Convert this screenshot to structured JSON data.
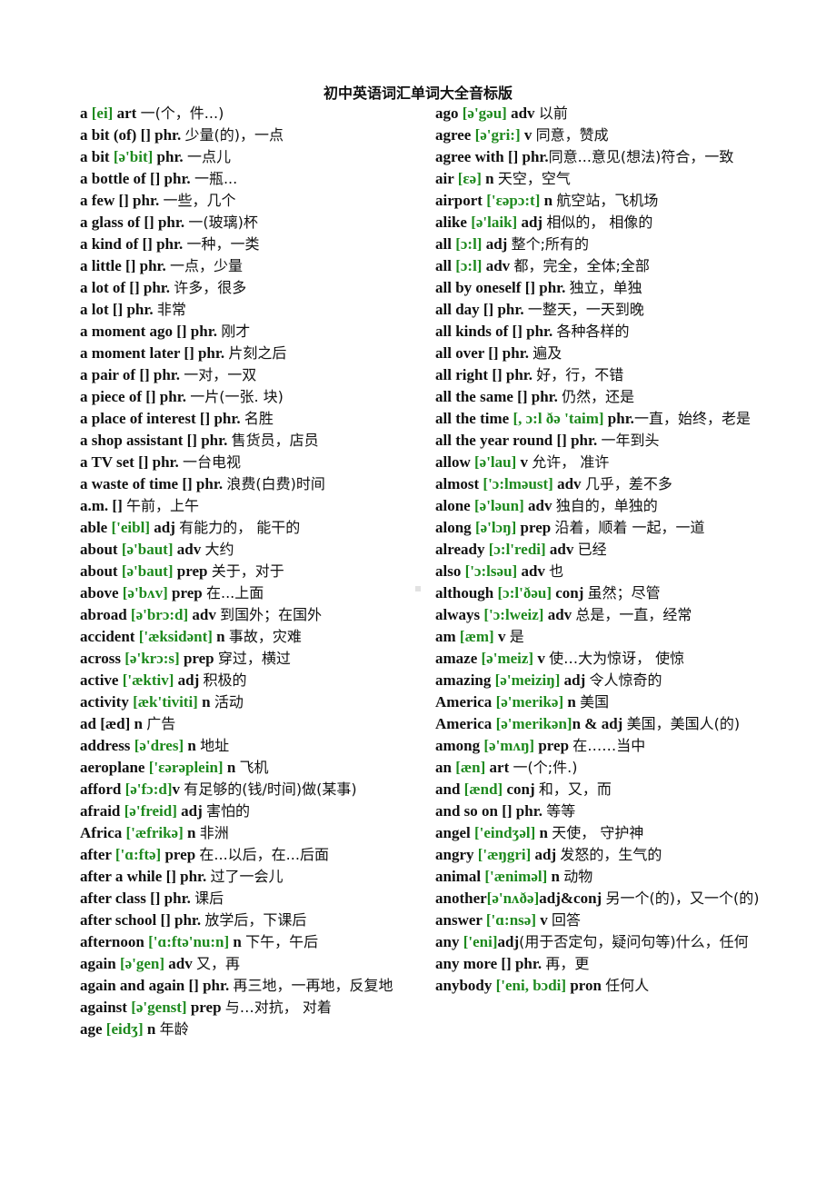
{
  "title": "初中英语词汇单词大全音标版",
  "colors": {
    "phonetic": "#1e8a1e",
    "text": "#111111"
  },
  "left_column": [
    {
      "word": "a ",
      "phonetic": "[ei]",
      "rest": " art ",
      "cn": "一(个，件...)"
    },
    {
      "word": "a bit (of) [] phr. ",
      "phonetic": "",
      "rest": "",
      "cn": "少量(的)，一点"
    },
    {
      "word": "a bit ",
      "phonetic": "[ə'bit]",
      "rest": " phr. ",
      "cn": "一点儿"
    },
    {
      "word": "a bottle of [] phr. ",
      "phonetic": "",
      "rest": "",
      "cn": "一瓶..."
    },
    {
      "word": "a few [] phr. ",
      "phonetic": "",
      "rest": "",
      "cn": "一些，几个"
    },
    {
      "word": "a glass of [] phr. ",
      "phonetic": "",
      "rest": "",
      "cn": "一(玻璃)杯"
    },
    {
      "word": "a kind of [] phr. ",
      "phonetic": "",
      "rest": "",
      "cn": "一种，一类"
    },
    {
      "word": "a little [] phr. ",
      "phonetic": "",
      "rest": "",
      "cn": "一点，少量"
    },
    {
      "word": "a lot of [] phr. ",
      "phonetic": "",
      "rest": "",
      "cn": "许多，很多"
    },
    {
      "word": "a lot [] phr. ",
      "phonetic": "",
      "rest": "",
      "cn": "非常"
    },
    {
      "word": "a moment ago [] phr. ",
      "phonetic": "",
      "rest": "",
      "cn": "刚才"
    },
    {
      "word": "a moment later [] phr. ",
      "phonetic": "",
      "rest": "",
      "cn": "片刻之后"
    },
    {
      "word": "a pair of [] phr. ",
      "phonetic": "",
      "rest": "",
      "cn": "一对，一双"
    },
    {
      "word": "a piece of [] phr. ",
      "phonetic": "",
      "rest": "",
      "cn": "一片(一张. 块)"
    },
    {
      "word": "a place of interest [] phr. ",
      "phonetic": "",
      "rest": "",
      "cn": "名胜"
    },
    {
      "word": "a shop assistant [] phr. ",
      "phonetic": "",
      "rest": "",
      "cn": "售货员，店员"
    },
    {
      "word": "a TV set [] phr. ",
      "phonetic": "",
      "rest": "",
      "cn": "一台电视"
    },
    {
      "word": "a waste of time [] phr. ",
      "phonetic": "",
      "rest": "",
      "cn": "浪费(白费)时间"
    },
    {
      "word": "a.m.    [] ",
      "phonetic": "",
      "rest": "",
      "cn": "午前，上午"
    },
    {
      "word": "able ",
      "phonetic": "['eibl]",
      "rest": " adj ",
      "cn": "有能力的， 能干的"
    },
    {
      "word": "about ",
      "phonetic": "[ə'baut]",
      "rest": " adv ",
      "cn": "大约"
    },
    {
      "word": "about ",
      "phonetic": "[ə'baut]",
      "rest": " prep ",
      "cn": "关于，对于"
    },
    {
      "word": "above ",
      "phonetic": "[ə'bʌv]",
      "rest": " prep ",
      "cn": "在...上面"
    },
    {
      "word": "abroad ",
      "phonetic": "[ə'brɔ:d]",
      "rest": " adv ",
      "cn": "到国外；在国外"
    },
    {
      "word": "accident ",
      "phonetic": "['æksidənt]",
      "rest": " n ",
      "cn": "事故，灾难"
    },
    {
      "word": "across ",
      "phonetic": "[ə'krɔ:s]",
      "rest": " prep ",
      "cn": "穿过，横过"
    },
    {
      "word": "active ",
      "phonetic": "['æktiv]",
      "rest": " adj ",
      "cn": "积极的"
    },
    {
      "word": "activity ",
      "phonetic": "[æk'tiviti]",
      "rest": " n ",
      "cn": "活动"
    },
    {
      "word": "ad [æd] n ",
      "phonetic": "",
      "rest": "",
      "cn": "广告"
    },
    {
      "word": "address ",
      "phonetic": "[ə'dres]",
      "rest": " n ",
      "cn": "地址"
    },
    {
      "word": "aeroplane ",
      "phonetic": "['ɛərəplein]",
      "rest": " n ",
      "cn": "飞机"
    },
    {
      "word": "afford ",
      "phonetic": "[ə'fɔ:d]",
      "rest": "v ",
      "cn": "有足够的(钱/时间)做(某事)"
    },
    {
      "word": "afraid ",
      "phonetic": "[ə'freid]",
      "rest": " adj ",
      "cn": "害怕的"
    },
    {
      "word": "Africa ",
      "phonetic": "['æfrikə]",
      "rest": " n ",
      "cn": "非洲"
    },
    {
      "word": "after ",
      "phonetic": "['ɑ:ftə]",
      "rest": " prep ",
      "cn": "在...以后，在...后面"
    },
    {
      "word": "after a while [] phr. ",
      "phonetic": "",
      "rest": "",
      "cn": "过了一会儿"
    },
    {
      "word": "after class [] phr. ",
      "phonetic": "",
      "rest": "",
      "cn": "课后"
    },
    {
      "word": "after school [] phr. ",
      "phonetic": "",
      "rest": "",
      "cn": "放学后，下课后"
    },
    {
      "word": "afternoon ",
      "phonetic": "['ɑ:ftə'nu:n]",
      "rest": " n ",
      "cn": "下午，午后"
    },
    {
      "word": "again ",
      "phonetic": "[ə'gen]",
      "rest": " adv ",
      "cn": "又，再"
    },
    {
      "word": "again and again    [] phr. ",
      "phonetic": "",
      "rest": "",
      "cn": "再三地，一再地，反复地"
    },
    {
      "word": "against ",
      "phonetic": "[ə'genst]",
      "rest": " prep ",
      "cn": "与…对抗， 对着"
    },
    {
      "word": "age ",
      "phonetic": "[eidʒ]",
      "rest": " n ",
      "cn": "年龄"
    }
  ],
  "right_column": [
    {
      "word": "ago ",
      "phonetic": "[ə'gəu]",
      "rest": " adv ",
      "cn": "以前"
    },
    {
      "word": "agree ",
      "phonetic": "[ə'gri:]",
      "rest": " v ",
      "cn": "同意，赞成"
    },
    {
      "word": "agree with    [] phr.",
      "phonetic": "",
      "rest": "",
      "cn": "同意...意见(想法)符合，一致"
    },
    {
      "word": "air ",
      "phonetic": "[ɛə]",
      "rest": " n ",
      "cn": "天空，空气"
    },
    {
      "word": "airport ",
      "phonetic": "['ɛəpɔ:t]",
      "rest": " n ",
      "cn": "航空站，飞机场"
    },
    {
      "word": "alike ",
      "phonetic": "[ə'laik]",
      "rest": " adj ",
      "cn": "相似的， 相像的"
    },
    {
      "word": "all ",
      "phonetic": "[ɔ:l]",
      "rest": " adj ",
      "cn": "整个;所有的"
    },
    {
      "word": "all ",
      "phonetic": "[ɔ:l]",
      "rest": " adv ",
      "cn": "都，完全，全体;全部"
    },
    {
      "word": "all by oneself [] phr. ",
      "phonetic": "",
      "rest": "",
      "cn": "独立，单独"
    },
    {
      "word": "all day [] phr. ",
      "phonetic": "",
      "rest": "",
      "cn": "一整天，一天到晚"
    },
    {
      "word": "all kinds of [] phr. ",
      "phonetic": "",
      "rest": "",
      "cn": "各种各样的"
    },
    {
      "word": "all over [] phr. ",
      "phonetic": "",
      "rest": "",
      "cn": "遍及"
    },
    {
      "word": "all right    [] phr. ",
      "phonetic": "",
      "rest": "",
      "cn": "好，行，不错"
    },
    {
      "word": "all the same [] phr. ",
      "phonetic": "",
      "rest": "",
      "cn": "仍然，还是"
    },
    {
      "word": "all the time ",
      "phonetic": "[, ɔ:l ðə 'taim]",
      "rest": " phr.",
      "cn": "一直，始终，老是"
    },
    {
      "word": "all the year round [] phr. ",
      "phonetic": "",
      "rest": "",
      "cn": "一年到头"
    },
    {
      "word": "allow ",
      "phonetic": "[ə'lau]",
      "rest": " v ",
      "cn": "允许， 准许"
    },
    {
      "word": "almost ",
      "phonetic": "['ɔ:lməust]",
      "rest": " adv ",
      "cn": "几乎，差不多"
    },
    {
      "word": "alone ",
      "phonetic": "[ə'ləun]",
      "rest": " adv ",
      "cn": "独自的，单独的"
    },
    {
      "word": "along ",
      "phonetic": "[ə'lɔŋ]",
      "rest": " prep ",
      "cn": "沿着，顺着 一起，一道"
    },
    {
      "word": "already ",
      "phonetic": "[ɔ:l'redi]",
      "rest": " adv ",
      "cn": "已经"
    },
    {
      "word": "also ",
      "phonetic": "['ɔ:lsəu]",
      "rest": " adv ",
      "cn": "也"
    },
    {
      "word": "although ",
      "phonetic": "[ɔ:l'ðəu]",
      "rest": " conj ",
      "cn": "虽然；尽管"
    },
    {
      "word": "always ",
      "phonetic": "['ɔ:lweiz]",
      "rest": " adv ",
      "cn": "总是，一直，经常"
    },
    {
      "word": "am ",
      "phonetic": "[æm]",
      "rest": " v ",
      "cn": "是"
    },
    {
      "word": "amaze ",
      "phonetic": "[ə'meiz]",
      "rest": " v ",
      "cn": "使…大为惊讶， 使惊"
    },
    {
      "word": "amazing ",
      "phonetic": "[ə'meiziŋ]",
      "rest": " adj ",
      "cn": "令人惊奇的"
    },
    {
      "word": "America ",
      "phonetic": "[ə'merikə]",
      "rest": " n ",
      "cn": "美国"
    },
    {
      "word": "America ",
      "phonetic": "[ə'merikən]",
      "rest": "n & adj ",
      "cn": "美国，美国人(的)"
    },
    {
      "word": "among ",
      "phonetic": "[ə'mʌŋ]",
      "rest": " prep ",
      "cn": "在……当中"
    },
    {
      "word": "an ",
      "phonetic": "[æn]",
      "rest": " art ",
      "cn": "一(个;件.)"
    },
    {
      "word": "and ",
      "phonetic": "[ænd]",
      "rest": " conj ",
      "cn": "和，又，而"
    },
    {
      "word": "and so on [] phr. ",
      "phonetic": "",
      "rest": "",
      "cn": "等等"
    },
    {
      "word": "angel ",
      "phonetic": "['eindʒəl]",
      "rest": " n ",
      "cn": "天使， 守护神"
    },
    {
      "word": "angry ",
      "phonetic": "['æŋgri]",
      "rest": " adj ",
      "cn": "发怒的，生气的"
    },
    {
      "word": "animal ",
      "phonetic": "['æniməl]",
      "rest": " n ",
      "cn": "动物"
    },
    {
      "word": "another",
      "phonetic": "[ə'nʌðə]",
      "rest": "adj&conj ",
      "cn": "另一个(的)，又一个(的)"
    },
    {
      "word": "answer ",
      "phonetic": "['ɑ:nsə]",
      "rest": " v ",
      "cn": "回答"
    },
    {
      "word": "any ",
      "phonetic": "['eni]",
      "rest": "adj",
      "cn": "(用于否定句，疑问句等)什么，任何"
    },
    {
      "word": "any more [] phr. ",
      "phonetic": "",
      "rest": "",
      "cn": "再，更"
    },
    {
      "word": "anybody ",
      "phonetic": "['eni, bɔdi]",
      "rest": " pron ",
      "cn": "任何人"
    }
  ]
}
